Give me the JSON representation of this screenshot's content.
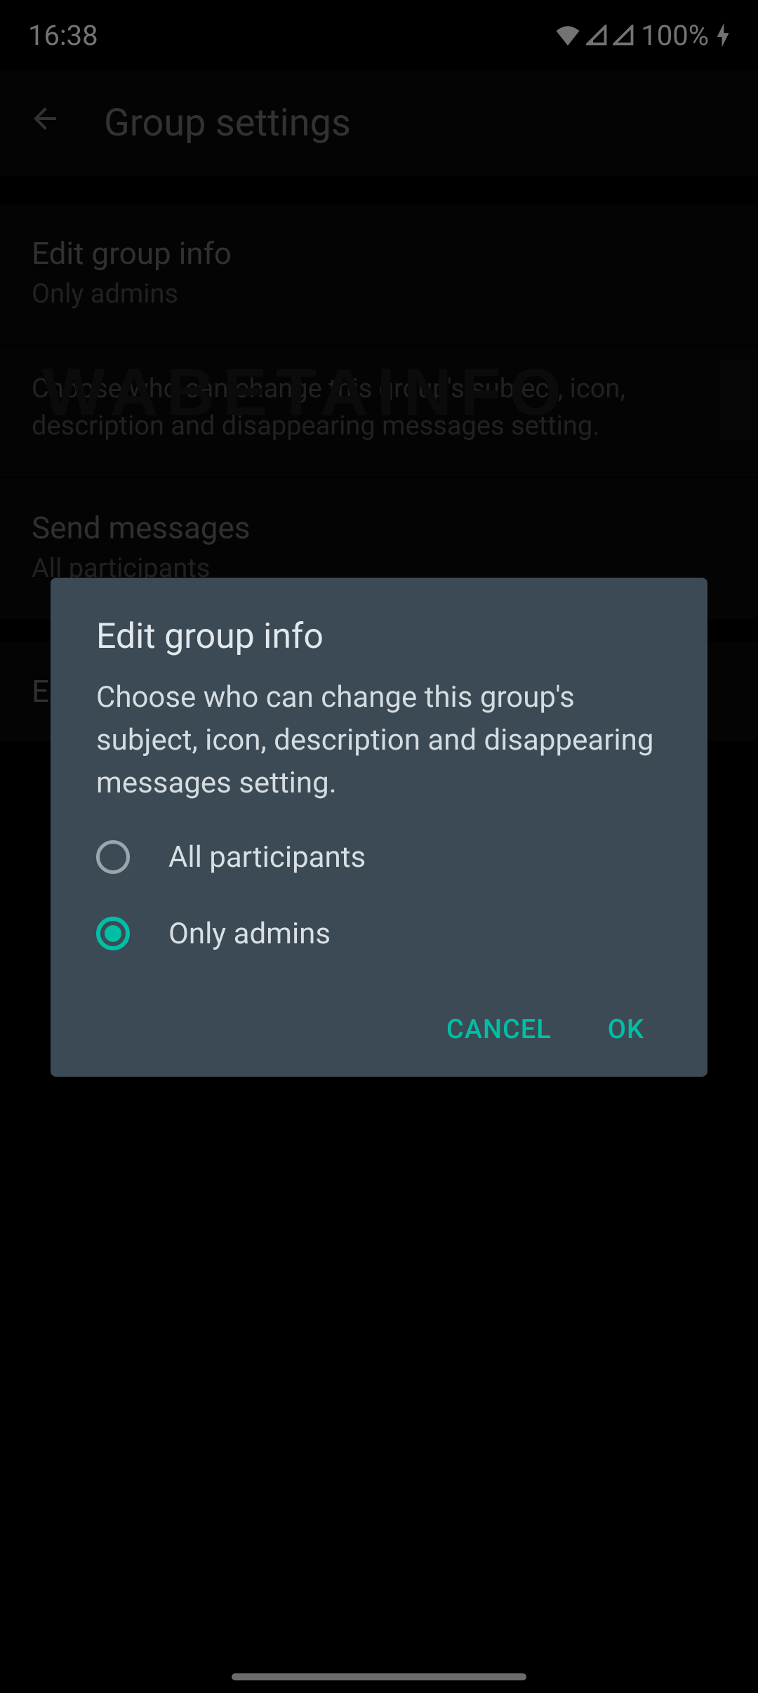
{
  "statusBar": {
    "time": "16:38",
    "battery": "100%"
  },
  "header": {
    "title": "Group settings"
  },
  "settings": {
    "editGroupInfo": {
      "title": "Edit group info",
      "subtitle": "Only admins",
      "description": "Choose who can change this group's subject, icon, description and disappearing messages setting."
    },
    "sendMessages": {
      "title": "Send messages",
      "subtitle": "All participants"
    },
    "partialItem": "E"
  },
  "dialog": {
    "title": "Edit group info",
    "description": "Choose who can change this group's subject, icon, description and disappearing messages setting.",
    "options": {
      "allParticipants": "All participants",
      "onlyAdmins": "Only admins"
    },
    "cancel": "CANCEL",
    "ok": "OK"
  },
  "watermark": "WABETAINFO"
}
